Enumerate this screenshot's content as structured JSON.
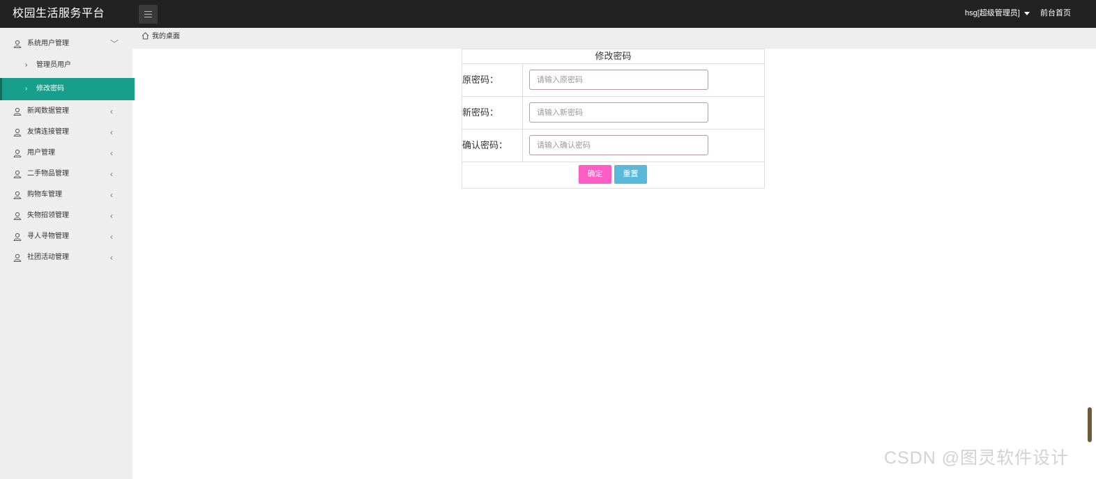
{
  "header": {
    "app_title": "校园生活服务平台",
    "menu_toggle_icon": "hamburger-icon",
    "user_label": "hsg[超级管理员]",
    "front_home_label": "前台首页"
  },
  "sidebar": {
    "items": [
      {
        "label": "系统用户管理",
        "arrow": "﹀",
        "expanded": true
      },
      {
        "label": "新闻数据管理",
        "arrow": "‹"
      },
      {
        "label": "友情连接管理",
        "arrow": "‹"
      },
      {
        "label": "用户管理",
        "arrow": "‹"
      },
      {
        "label": "二手物品管理",
        "arrow": "‹"
      },
      {
        "label": "购物车管理",
        "arrow": "‹"
      },
      {
        "label": "失物招领管理",
        "arrow": "‹"
      },
      {
        "label": "寻人寻物管理",
        "arrow": "‹"
      },
      {
        "label": "社团活动管理",
        "arrow": "‹"
      }
    ],
    "sub_items": [
      {
        "label": "管理员用户",
        "chevron": "›"
      },
      {
        "label": "修改密码",
        "chevron": "›",
        "active": true
      }
    ],
    "active_color": "#189f8b"
  },
  "breadcrumb": {
    "label": "我的桌面",
    "icon": "home-icon"
  },
  "form": {
    "title": "修改密码",
    "fields": [
      {
        "label": "原密码：",
        "placeholder": "请输入原密码",
        "value": ""
      },
      {
        "label": "新密码：",
        "placeholder": "请输入新密码",
        "value": ""
      },
      {
        "label": "确认密码：",
        "placeholder": "请输入确认密码",
        "value": ""
      }
    ],
    "confirm_label": "确定",
    "reset_label": "重置",
    "confirm_color": "#ff5cc4",
    "reset_color": "#5ab9d9"
  },
  "watermark": "CSDN @图灵软件设计"
}
